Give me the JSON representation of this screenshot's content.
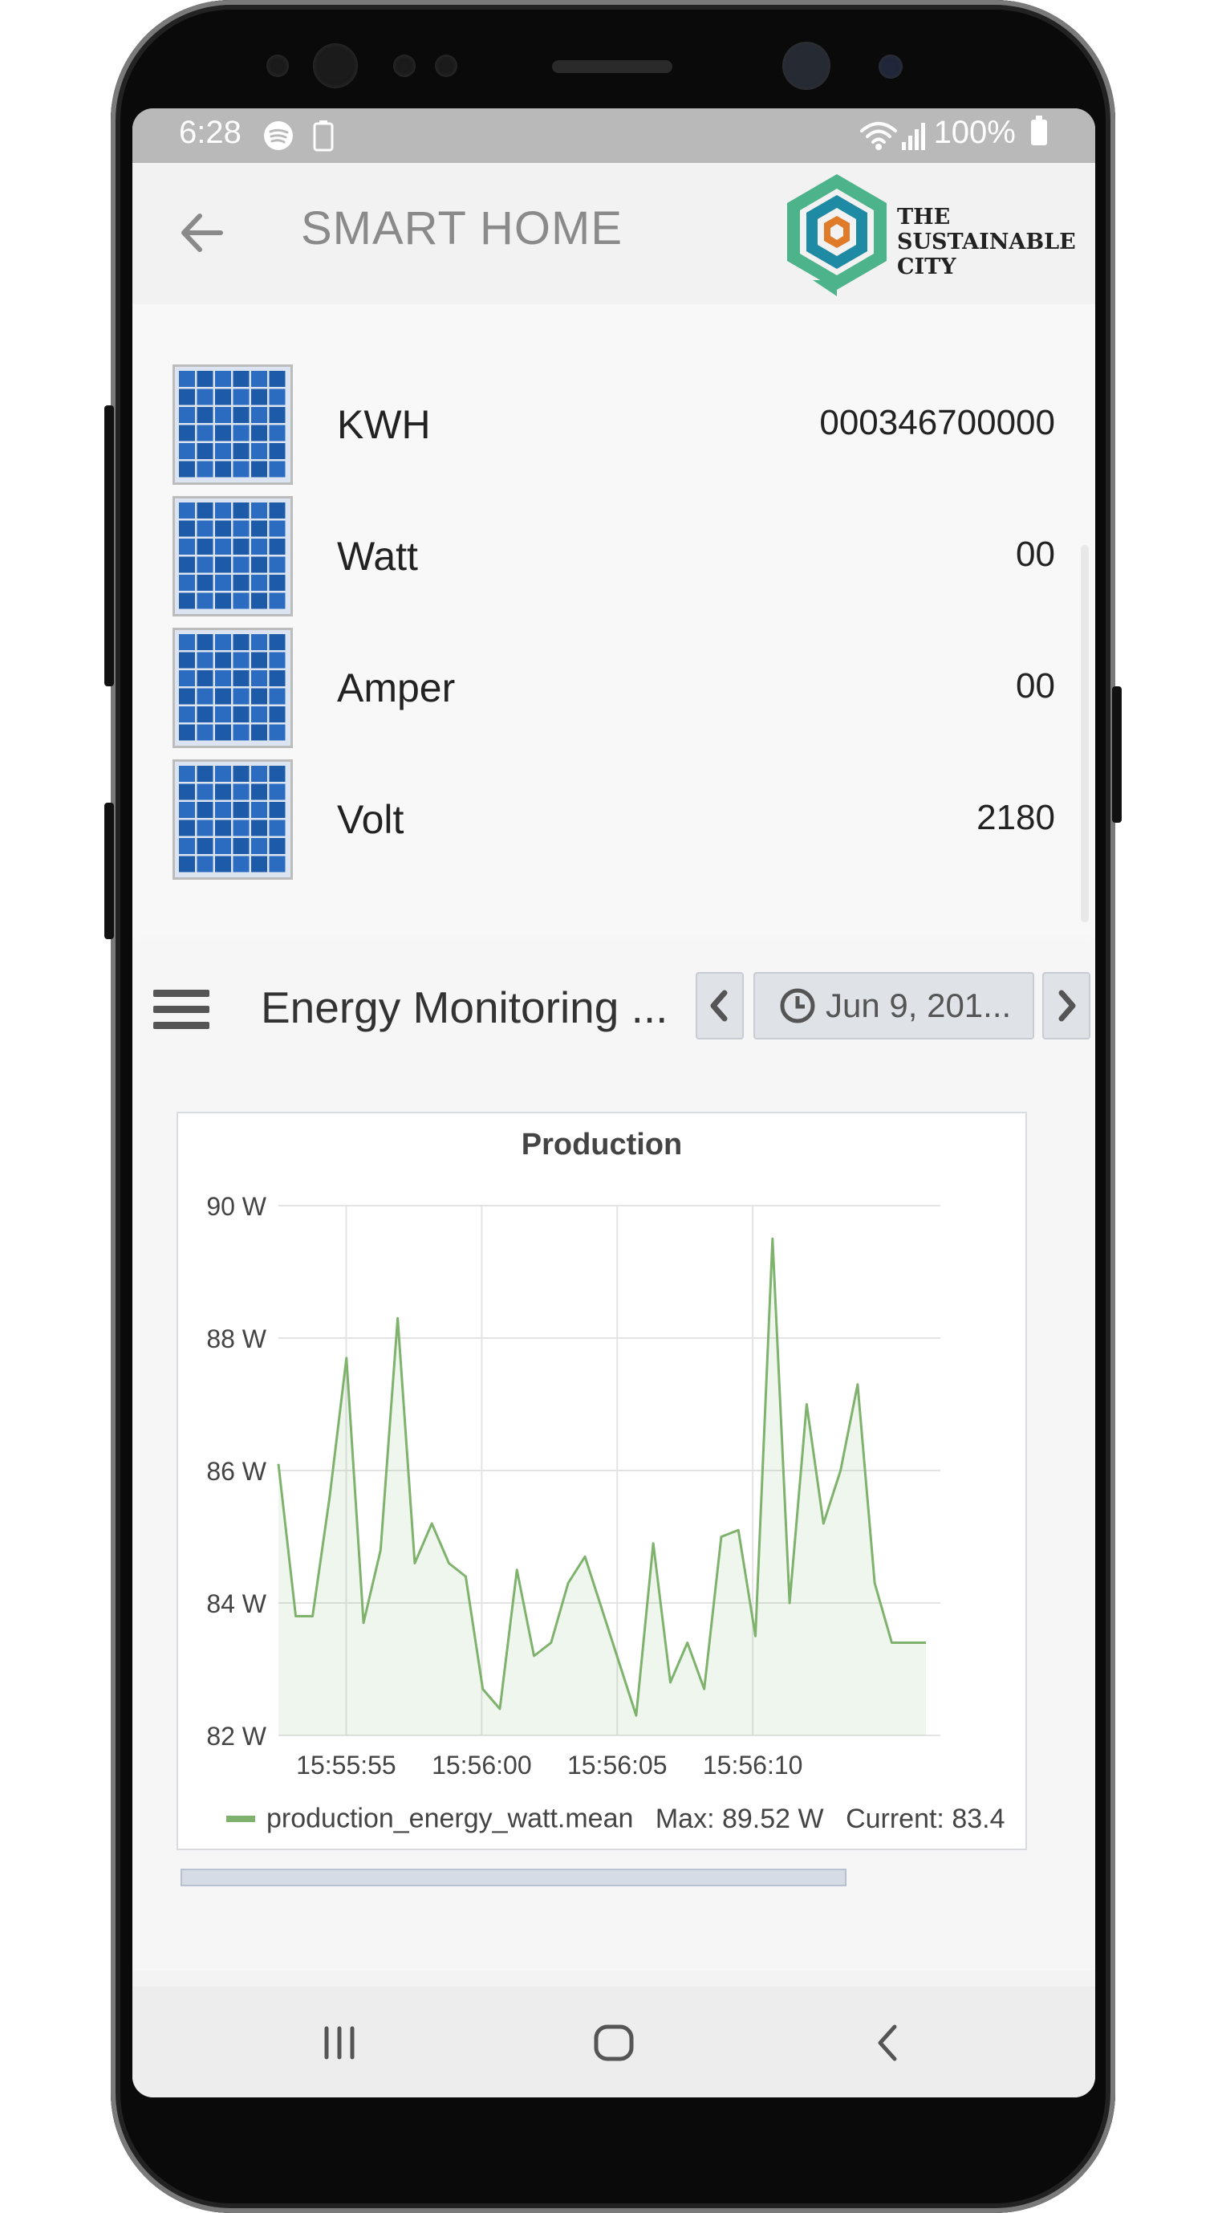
{
  "status_bar": {
    "time": "6:28",
    "battery": "100%",
    "icons": [
      "spotify-icon",
      "battery-saver-icon",
      "wifi-icon",
      "signal-icon",
      "battery-icon"
    ]
  },
  "app_bar": {
    "title": "SMART HOME",
    "logo_text": [
      "THE",
      "SUSTAINABLE",
      "CITY"
    ]
  },
  "readings": [
    {
      "label": "KWH",
      "value": "000346700000"
    },
    {
      "label": "Watt",
      "value": "00"
    },
    {
      "label": "Amper",
      "value": "00"
    },
    {
      "label": "Volt",
      "value": "2180"
    }
  ],
  "dashboard": {
    "title": "Energy Monitoring ...",
    "time_range": "Jun 9, 201..."
  },
  "chart_data": {
    "type": "line",
    "title": "Production",
    "xlabel": "",
    "ylabel": "",
    "ylim": [
      82,
      90
    ],
    "y_ticks": [
      "90 W",
      "88 W",
      "86 W",
      "84 W",
      "82 W"
    ],
    "x_ticks": [
      "15:55:55",
      "15:56:00",
      "15:56:05",
      "15:56:10"
    ],
    "grid": true,
    "series": [
      {
        "name": "production_energy_watt.mean",
        "color": "#7eb26d",
        "x": [
          0.0,
          0.64,
          1.26,
          1.89,
          2.51,
          3.14,
          3.77,
          4.4,
          5.03,
          5.66,
          6.29,
          6.91,
          7.54,
          8.17,
          8.8,
          9.43,
          10.06,
          10.69,
          11.31,
          11.94,
          12.57,
          13.2,
          13.83,
          14.46,
          15.09,
          15.71,
          16.34,
          16.97,
          17.6,
          18.23,
          18.86,
          19.49,
          20.11,
          20.74,
          21.37,
          22.0,
          22.63,
          23.26,
          23.89
        ],
        "values": [
          86.1,
          83.8,
          83.8,
          85.6,
          87.7,
          83.7,
          84.8,
          88.3,
          84.6,
          85.2,
          84.6,
          84.4,
          82.7,
          82.4,
          84.5,
          83.2,
          83.4,
          84.3,
          84.7,
          83.9,
          83.1,
          82.3,
          84.9,
          82.8,
          83.4,
          82.7,
          85.0,
          85.1,
          83.5,
          89.5,
          84.0,
          87.0,
          85.2,
          86.0,
          87.3,
          84.3,
          83.4,
          83.4,
          83.4
        ]
      }
    ],
    "legend": {
      "label": "production_energy_watt.mean",
      "max": "Max: 89.52 W",
      "current": "Current: 83.4"
    }
  },
  "nav_bar": {
    "icons": [
      "recent-apps-icon",
      "home-icon",
      "back-icon"
    ]
  }
}
